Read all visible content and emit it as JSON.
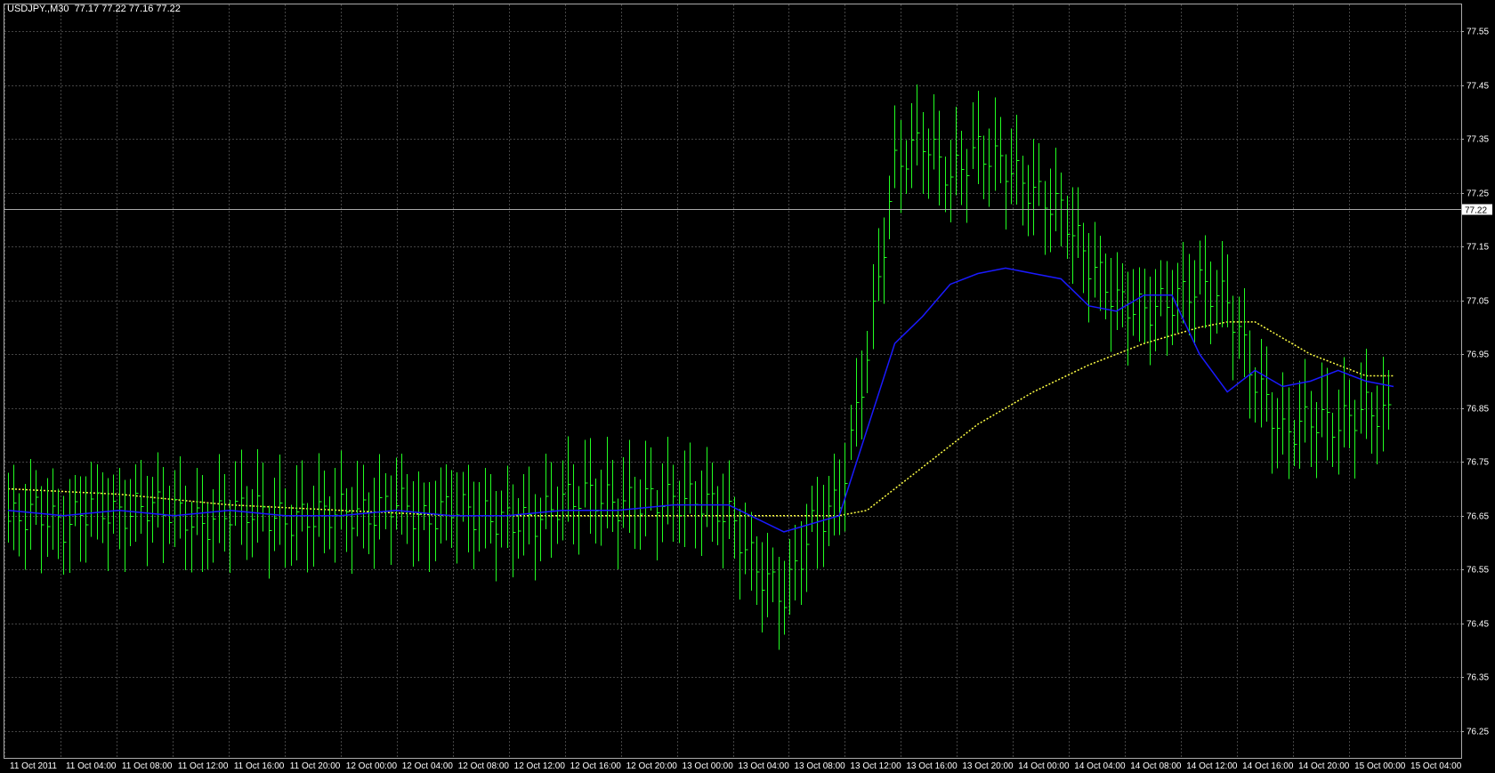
{
  "header": {
    "symbol": "USDJPY.,M30",
    "ohlc": "77.17 77.22 77.16 77.22"
  },
  "colors": {
    "background": "#000000",
    "bars": "#22ff22",
    "ma_fast": "#1a1aff",
    "ma_slow": "#ffff44",
    "grid": "#444444",
    "current_price_line": "#aaaaaa",
    "label_box": "#ffffff"
  },
  "chart_data": {
    "type": "line",
    "title": "USDJPY.,M30",
    "ylim": [
      76.2,
      77.6
    ],
    "yticks": [
      "77.55",
      "77.45",
      "77.35",
      "77.25",
      "77.15",
      "77.05",
      "76.95",
      "76.85",
      "76.75",
      "76.65",
      "76.55",
      "76.45",
      "76.35",
      "76.25"
    ],
    "current_price": "77.22",
    "xticks": [
      "11 Oct 2011",
      "11 Oct 04:00",
      "11 Oct 08:00",
      "11 Oct 12:00",
      "11 Oct 16:00",
      "11 Oct 20:00",
      "12 Oct 00:00",
      "12 Oct 04:00",
      "12 Oct 08:00",
      "12 Oct 12:00",
      "12 Oct 16:00",
      "12 Oct 20:00",
      "13 Oct 00:00",
      "13 Oct 04:00",
      "13 Oct 08:00",
      "13 Oct 12:00",
      "13 Oct 16:00",
      "13 Oct 20:00",
      "14 Oct 00:00",
      "14 Oct 04:00",
      "14 Oct 08:00",
      "14 Oct 12:00",
      "14 Oct 16:00",
      "14 Oct 20:00",
      "15 Oct 00:00",
      "15 Oct 04:00"
    ],
    "grid": true,
    "series": [
      {
        "style": "bars",
        "x": [
          0,
          2,
          4,
          6,
          8,
          10,
          12,
          14,
          16,
          18,
          20,
          22,
          24,
          26,
          28,
          30,
          32,
          34,
          36,
          38,
          40,
          42,
          44,
          46,
          48,
          50,
          52,
          54,
          56,
          58,
          60,
          62,
          64,
          66,
          68,
          70,
          72,
          74,
          76,
          78,
          80,
          82,
          84,
          86,
          88,
          90,
          92,
          94,
          96,
          98,
          100
        ],
        "values": [
          76.64,
          76.66,
          76.63,
          76.67,
          76.65,
          76.67,
          76.66,
          76.63,
          76.66,
          76.66,
          76.64,
          76.65,
          76.66,
          76.65,
          76.68,
          76.64,
          76.67,
          76.65,
          76.64,
          76.64,
          76.68,
          76.69,
          76.67,
          76.68,
          76.68,
          76.68,
          76.65,
          76.55,
          76.5,
          76.63,
          76.68,
          76.95,
          77.3,
          77.35,
          77.28,
          77.33,
          77.3,
          77.25,
          77.22,
          77.12,
          77.05,
          77.03,
          77.05,
          77.08,
          77.05,
          76.9,
          76.8,
          76.83,
          76.82,
          76.85,
          76.83
        ]
      },
      {
        "style": "line",
        "x": [
          0,
          4,
          8,
          12,
          16,
          20,
          24,
          28,
          32,
          36,
          40,
          44,
          48,
          52,
          56,
          60,
          64,
          66,
          68,
          70,
          72,
          74,
          76,
          78,
          80,
          82,
          84,
          86,
          88,
          90,
          92,
          94,
          96,
          98,
          100
        ],
        "values": [
          76.66,
          76.65,
          76.66,
          76.65,
          76.66,
          76.65,
          76.65,
          76.66,
          76.65,
          76.65,
          76.66,
          76.66,
          76.67,
          76.67,
          76.62,
          76.65,
          76.97,
          77.02,
          77.08,
          77.1,
          77.11,
          77.1,
          77.09,
          77.04,
          77.03,
          77.06,
          77.06,
          76.95,
          76.88,
          76.92,
          76.89,
          76.9,
          76.92,
          76.9,
          76.89
        ]
      },
      {
        "style": "dotted",
        "x": [
          0,
          8,
          16,
          24,
          32,
          40,
          48,
          56,
          60,
          62,
          66,
          70,
          74,
          78,
          82,
          86,
          88,
          90,
          92,
          94,
          96,
          98,
          100
        ],
        "values": [
          76.7,
          76.69,
          76.67,
          76.66,
          76.65,
          76.65,
          76.65,
          76.65,
          76.65,
          76.66,
          76.74,
          76.82,
          76.88,
          76.93,
          76.97,
          77.0,
          77.01,
          77.01,
          76.98,
          76.95,
          76.93,
          76.91,
          76.91
        ]
      }
    ]
  }
}
